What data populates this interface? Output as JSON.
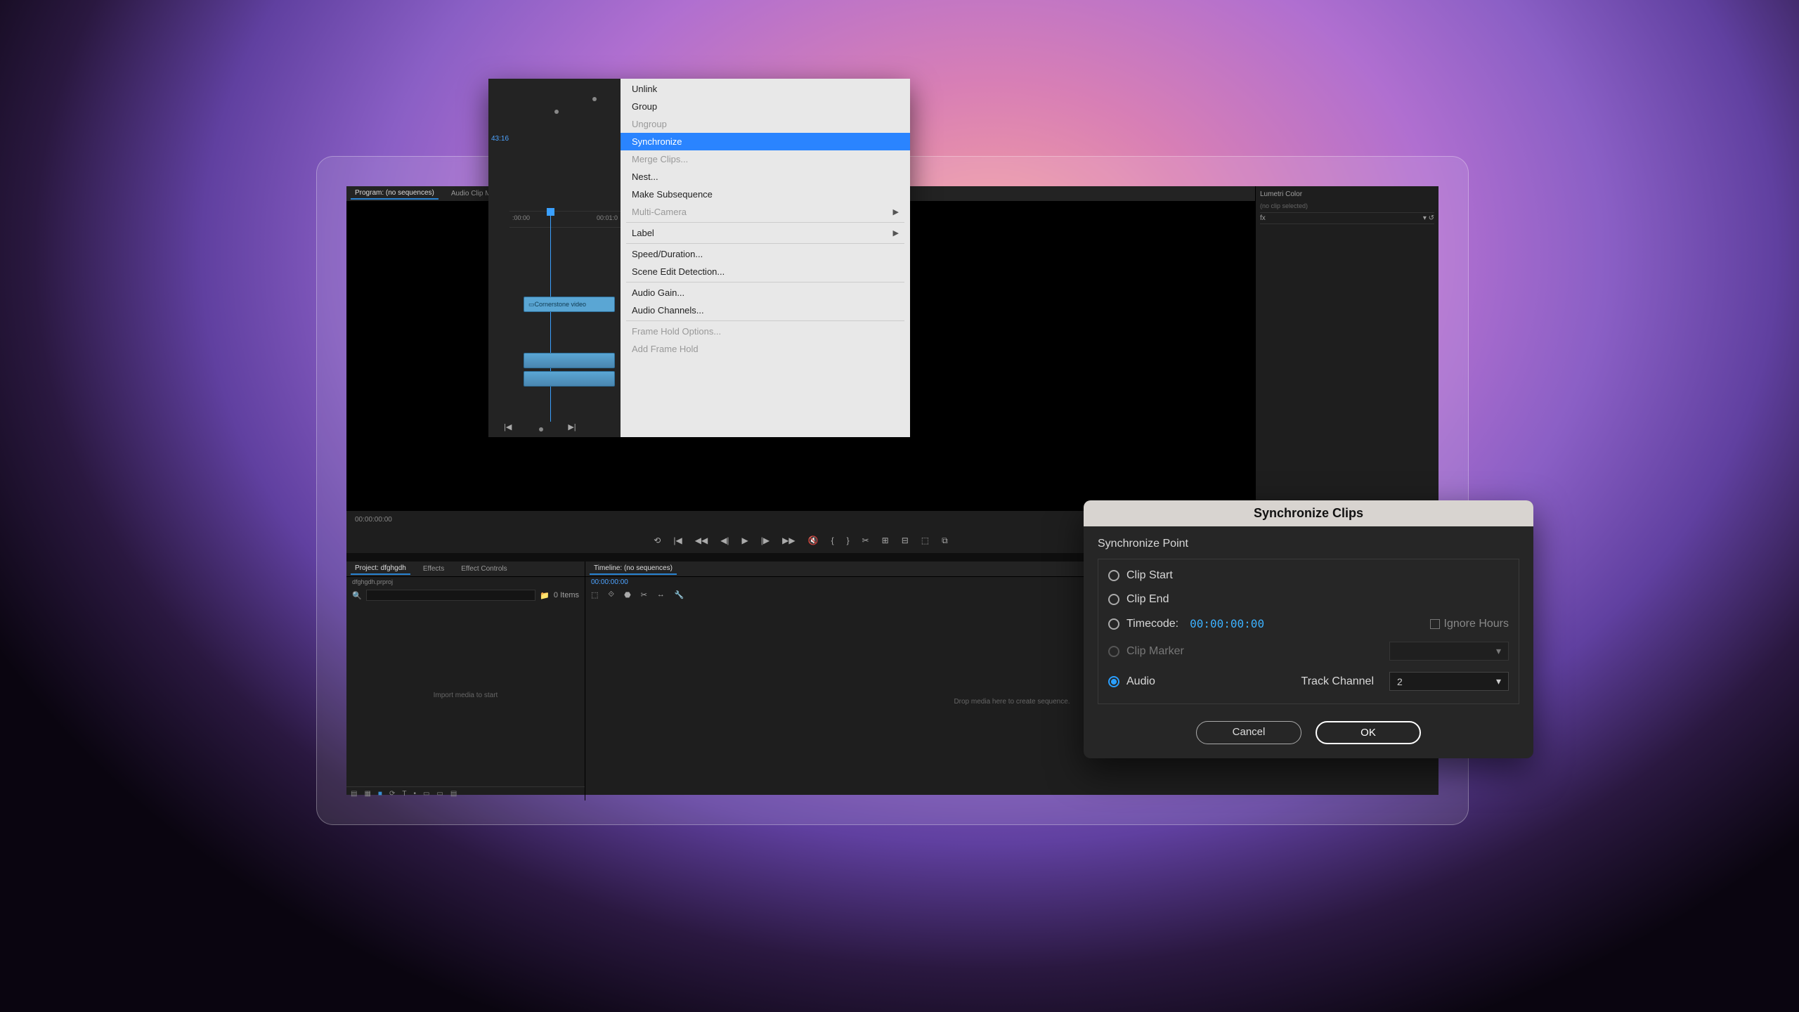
{
  "editor": {
    "program_tab": "Program: (no sequences)",
    "audio_mix_tab": "Audio Clip Mi",
    "tc_left": "00:00:00:00",
    "transport_icons": [
      "⟲",
      "|◀",
      "◀◀",
      "◀|",
      "▶",
      "|▶",
      "▶▶",
      "🔇",
      "{",
      "}",
      "✂",
      "⊞",
      "⊟",
      "⬚",
      "⧉"
    ],
    "lumetri": {
      "title": "Lumetri Color",
      "noclip": "(no clip selected)",
      "fx": "fx"
    },
    "project": {
      "tab_project": "Project: dfghgdh",
      "tab_effects": "Effects",
      "tab_effect_controls": "Effect Controls",
      "subtitle": "dfghgdh.prproj",
      "search_placeholder": "",
      "items_text": "0 Items",
      "empty": "Import media to start"
    },
    "timeline": {
      "tab": "Timeline: (no sequences)",
      "tc": "00:00:00:00",
      "empty": "Drop media here to create sequence."
    },
    "foot_icons": [
      "▤",
      "▦",
      "■",
      "⟳",
      "T",
      "•",
      "▭",
      "▭",
      "▤"
    ]
  },
  "float": {
    "tc_badge": "43:16",
    "ruler": [
      ":00:00",
      "00:01:0"
    ],
    "clip_video": "Cornerstone video",
    "bottom_icons": [
      "|◀",
      "▶|"
    ]
  },
  "context_menu": [
    {
      "label": "Unlink",
      "disabled": false
    },
    {
      "label": "Group",
      "disabled": false
    },
    {
      "label": "Ungroup",
      "disabled": true
    },
    {
      "label": "Synchronize",
      "highlight": true
    },
    {
      "label": "Merge Clips...",
      "disabled": true
    },
    {
      "label": "Nest...",
      "disabled": false
    },
    {
      "label": "Make Subsequence",
      "disabled": false
    },
    {
      "label": "Multi-Camera",
      "disabled": true,
      "submenu": true
    },
    {
      "sep": true
    },
    {
      "label": "Label",
      "submenu": true
    },
    {
      "sep": true
    },
    {
      "label": "Speed/Duration...",
      "disabled": false
    },
    {
      "label": "Scene Edit Detection...",
      "disabled": false
    },
    {
      "sep": true
    },
    {
      "label": "Audio Gain...",
      "disabled": false
    },
    {
      "label": "Audio Channels...",
      "disabled": false
    },
    {
      "sep": true
    },
    {
      "label": "Frame Hold Options...",
      "disabled": true
    },
    {
      "label": "Add Frame Hold",
      "disabled": true
    }
  ],
  "sync": {
    "title": "Synchronize Clips",
    "section": "Synchronize Point",
    "clip_start": "Clip Start",
    "clip_end": "Clip End",
    "timecode_label": "Timecode:",
    "timecode_value": "00:00:00:00",
    "ignore_hours": "Ignore Hours",
    "clip_marker": "Clip Marker",
    "audio": "Audio",
    "track_channel_label": "Track Channel",
    "track_channel_value": "2",
    "cancel": "Cancel",
    "ok": "OK"
  }
}
